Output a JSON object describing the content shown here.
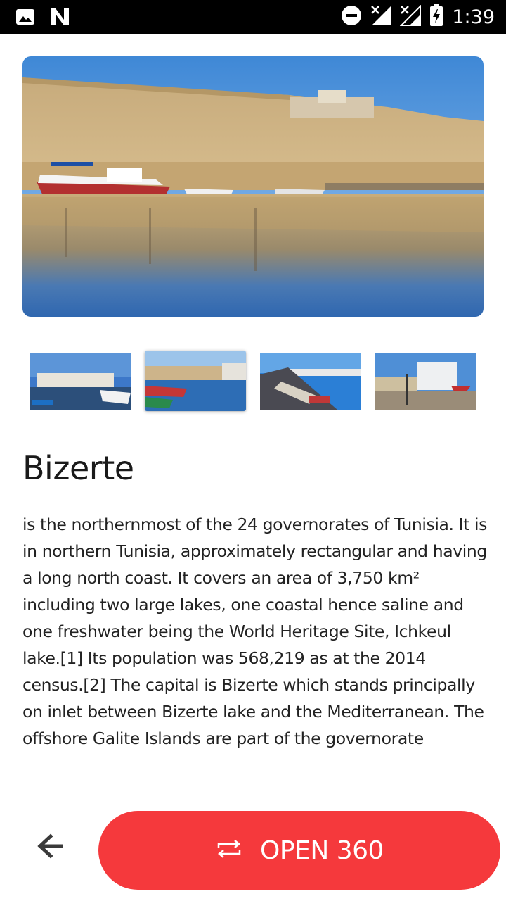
{
  "status_bar": {
    "time": "1:39",
    "left_icons": [
      "image-icon",
      "n-logo-icon"
    ],
    "right_icons": [
      "do-not-disturb-icon",
      "signal-no-data-icon",
      "signal-no-data-icon",
      "battery-charging-icon"
    ]
  },
  "hero": {
    "alt": "Bizerte old port and fortress wall reflected in the water"
  },
  "gallery": {
    "thumbnails": [
      {
        "name": "thumbnail-1"
      },
      {
        "name": "thumbnail-2",
        "selected": true
      },
      {
        "name": "thumbnail-3"
      },
      {
        "name": "thumbnail-4"
      }
    ]
  },
  "place": {
    "title": "Bizerte",
    "description": "is the northernmost of the 24 governorates of Tunisia.  It is in northern Tunisia, approximately rectangular and having a long north coast.  It covers an area of 3,750 km² including two large lakes, one coastal hence saline and one freshwater being the World  Heritage Site,  Ichkeul lake.[1]  Its population was 568,219 as at the 2014 census.[2] The capital is  Bizerte which stands principally on inlet between  Bizerte lake and the Mediterranean. The offshore Galite  Islands are part of the governorate"
  },
  "actions": {
    "back_icon": "arrow-back-icon",
    "open360_label": "OPEN 360",
    "open360_icon": "repeat-icon",
    "accent_color": "#f5393c"
  }
}
